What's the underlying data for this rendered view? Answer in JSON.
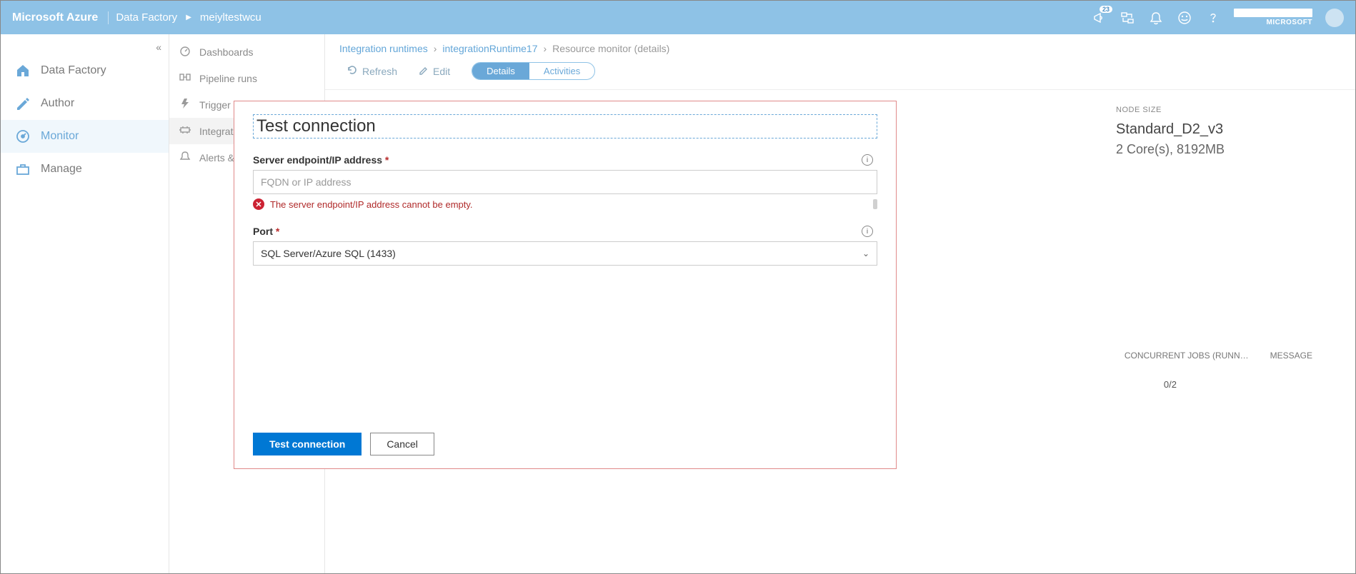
{
  "topbar": {
    "brand": "Microsoft Azure",
    "service": "Data Factory",
    "resource": "meiyltestwcu",
    "badge_count": "23",
    "tenant": "MICROSOFT"
  },
  "leftnav1": {
    "items": [
      {
        "label": "Data Factory"
      },
      {
        "label": "Author"
      },
      {
        "label": "Monitor"
      },
      {
        "label": "Manage"
      }
    ]
  },
  "leftnav2": {
    "items": [
      {
        "label": "Dashboards"
      },
      {
        "label": "Pipeline runs"
      },
      {
        "label": "Trigger runs"
      },
      {
        "label": "Integrati…"
      },
      {
        "label": "Alerts &…"
      }
    ]
  },
  "breadcrumb": {
    "a": "Integration runtimes",
    "b": "integrationRuntime17",
    "c": "Resource monitor (details)"
  },
  "toolbar": {
    "refresh": "Refresh",
    "edit": "Edit",
    "details": "Details",
    "activities": "Activities"
  },
  "behind": {
    "node_size_label": "NODE SIZE",
    "node_size_value": "Standard_D2_v3",
    "node_size_desc": "2 Core(s), 8192MB",
    "col_jobs": "CONCURRENT JOBS (RUNN…",
    "col_msg": "MESSAGE",
    "jobs_value": "0/2"
  },
  "dialog": {
    "title": "Test connection",
    "server_label": "Server endpoint/IP address",
    "server_placeholder": "FQDN or IP address",
    "server_error": "The server endpoint/IP address cannot be empty.",
    "port_label": "Port",
    "port_value": "SQL Server/Azure SQL (1433)",
    "btn_test": "Test connection",
    "btn_cancel": "Cancel"
  }
}
